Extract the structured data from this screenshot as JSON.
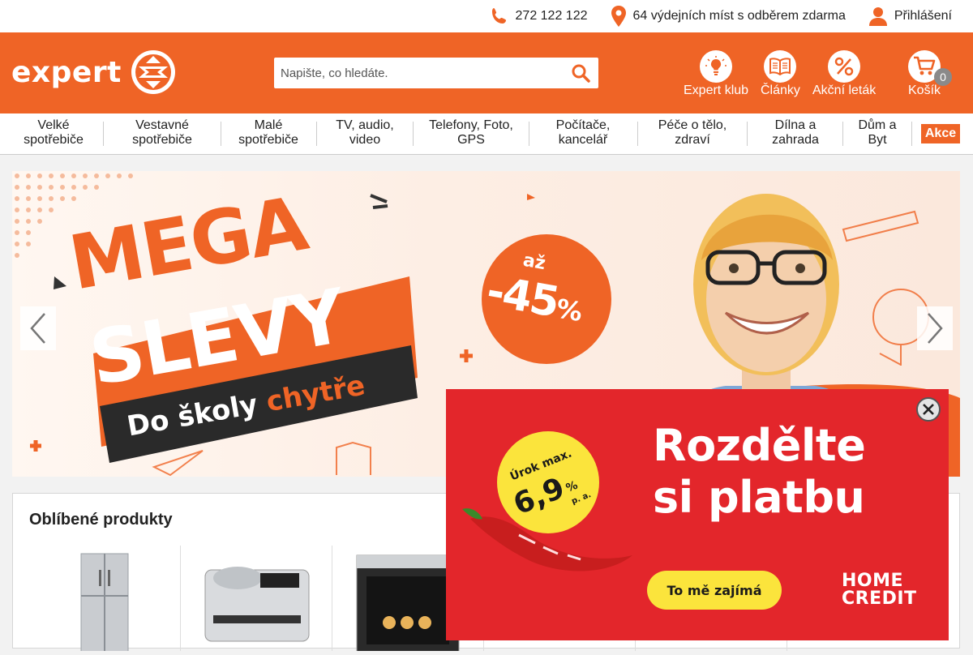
{
  "topbar": {
    "phone": "272 122 122",
    "pickup": "64 výdejních míst s odběrem zdarma",
    "login": "Přihlášení"
  },
  "header": {
    "logo_text": "expert",
    "search_placeholder": "Napište, co hledáte.",
    "icons": [
      {
        "label": "Expert klub",
        "icon": "bulb-icon"
      },
      {
        "label": "Články",
        "icon": "book-icon"
      },
      {
        "label": "Akční leták",
        "icon": "percent-icon"
      },
      {
        "label": "Košík",
        "icon": "cart-icon"
      }
    ],
    "cart_count": "0",
    "brand_color": "#ef6426"
  },
  "nav": {
    "categories": [
      {
        "line1": "Velké",
        "line2": "spotřebiče"
      },
      {
        "line1": "Vestavné",
        "line2": "spotřebiče"
      },
      {
        "line1": "Malé",
        "line2": "spotřebiče"
      },
      {
        "line1": "TV, audio,",
        "line2": "video"
      },
      {
        "line1": "Telefony, Foto,",
        "line2": "GPS"
      },
      {
        "line1": "Počítače,",
        "line2": "kancelář"
      },
      {
        "line1": "Péče o tělo,",
        "line2": "zdraví"
      },
      {
        "line1": "Dílna a",
        "line2": "zahrada"
      },
      {
        "line1": "Dům a",
        "line2": "Byt"
      }
    ],
    "akce": "Akce"
  },
  "banner": {
    "line1": "MEGA",
    "line2": "SLEVY",
    "ribbon_a": "Do školy ",
    "ribbon_b": "chytře",
    "badge_top": "až",
    "badge_main": "-45",
    "badge_pct": "%"
  },
  "favorites": {
    "title": "Oblíbené produkty"
  },
  "popup": {
    "title_1": "Rozdělte",
    "title_2": "si platbu",
    "rate_label": "Úrok max.",
    "rate_value": "6,9",
    "rate_unit": "%",
    "rate_pa": "p. a.",
    "cta": "To mě zajímá",
    "brand_1": "HOME",
    "brand_2": "CREDIT",
    "bg_color": "#e3262b",
    "accent_color": "#fbe43c"
  }
}
